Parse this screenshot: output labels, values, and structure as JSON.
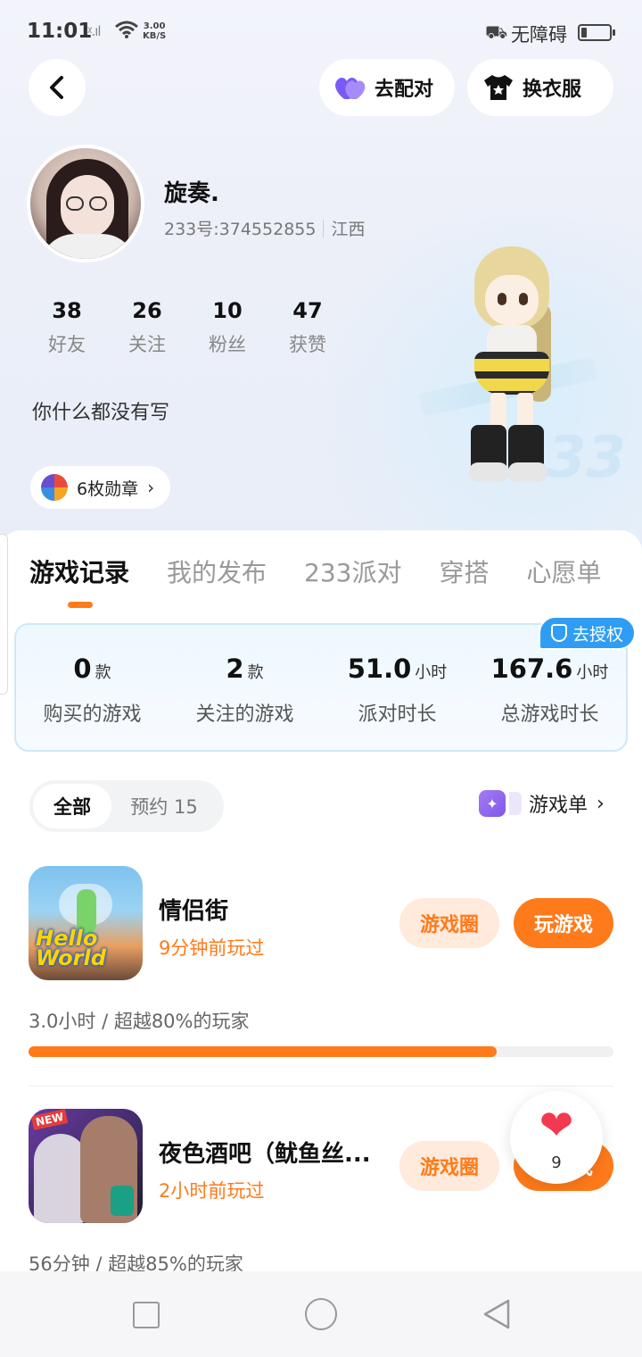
{
  "status_bar": {
    "time": "11:01",
    "signal": "ᵡ.ıl",
    "net_speed_value": "3.00",
    "net_speed_unit": "KB/S",
    "accessibility_label": "无障碍"
  },
  "header": {
    "match_label": "去配对",
    "dress_label": "换衣服"
  },
  "profile": {
    "nickname": "旋奏.",
    "uid": "233号:374552855",
    "region": "江西",
    "stats": [
      {
        "value": "38",
        "label": "好友"
      },
      {
        "value": "26",
        "label": "关注"
      },
      {
        "value": "10",
        "label": "粉丝"
      },
      {
        "value": "47",
        "label": "获赞"
      }
    ],
    "bio": "你什么都没有写",
    "medal_label": "6枚勋章",
    "model_badge": "233"
  },
  "tabs": [
    "游戏记录",
    "我的发布",
    "233派对",
    "穿搭",
    "心愿单"
  ],
  "active_tab": 0,
  "summary": {
    "auth_label": "去授权",
    "items": [
      {
        "value": "0",
        "unit": "款",
        "label": "购买的游戏"
      },
      {
        "value": "2",
        "unit": "款",
        "label": "关注的游戏"
      },
      {
        "value": "51.0",
        "unit": "小时",
        "label": "派对时长"
      },
      {
        "value": "167.6",
        "unit": "小时",
        "label": "总游戏时长"
      }
    ]
  },
  "filter": {
    "all_label": "全部",
    "reserve_label": "预约 15",
    "gamelist_label": "游戏单"
  },
  "games": [
    {
      "title": "情侣街",
      "played": "9分钟前玩过",
      "circle_label": "游戏圈",
      "play_label": "玩游戏",
      "meta": "3.0小时 / 超越80%的玩家",
      "progress": 0.8,
      "thumb_text": "Hello World"
    },
    {
      "title": "夜色酒吧（鱿鱼丝...",
      "played": "2小时前玩过",
      "circle_label": "游戏圈",
      "play_label": "玩游戏",
      "meta": "56分钟 / 超越85%的玩家",
      "thumb_badge": "NEW"
    }
  ],
  "like_float": {
    "count": "9"
  },
  "colors": {
    "accent": "#ff7a1a",
    "auth": "#2f9df3",
    "heart": "#f2394f"
  }
}
